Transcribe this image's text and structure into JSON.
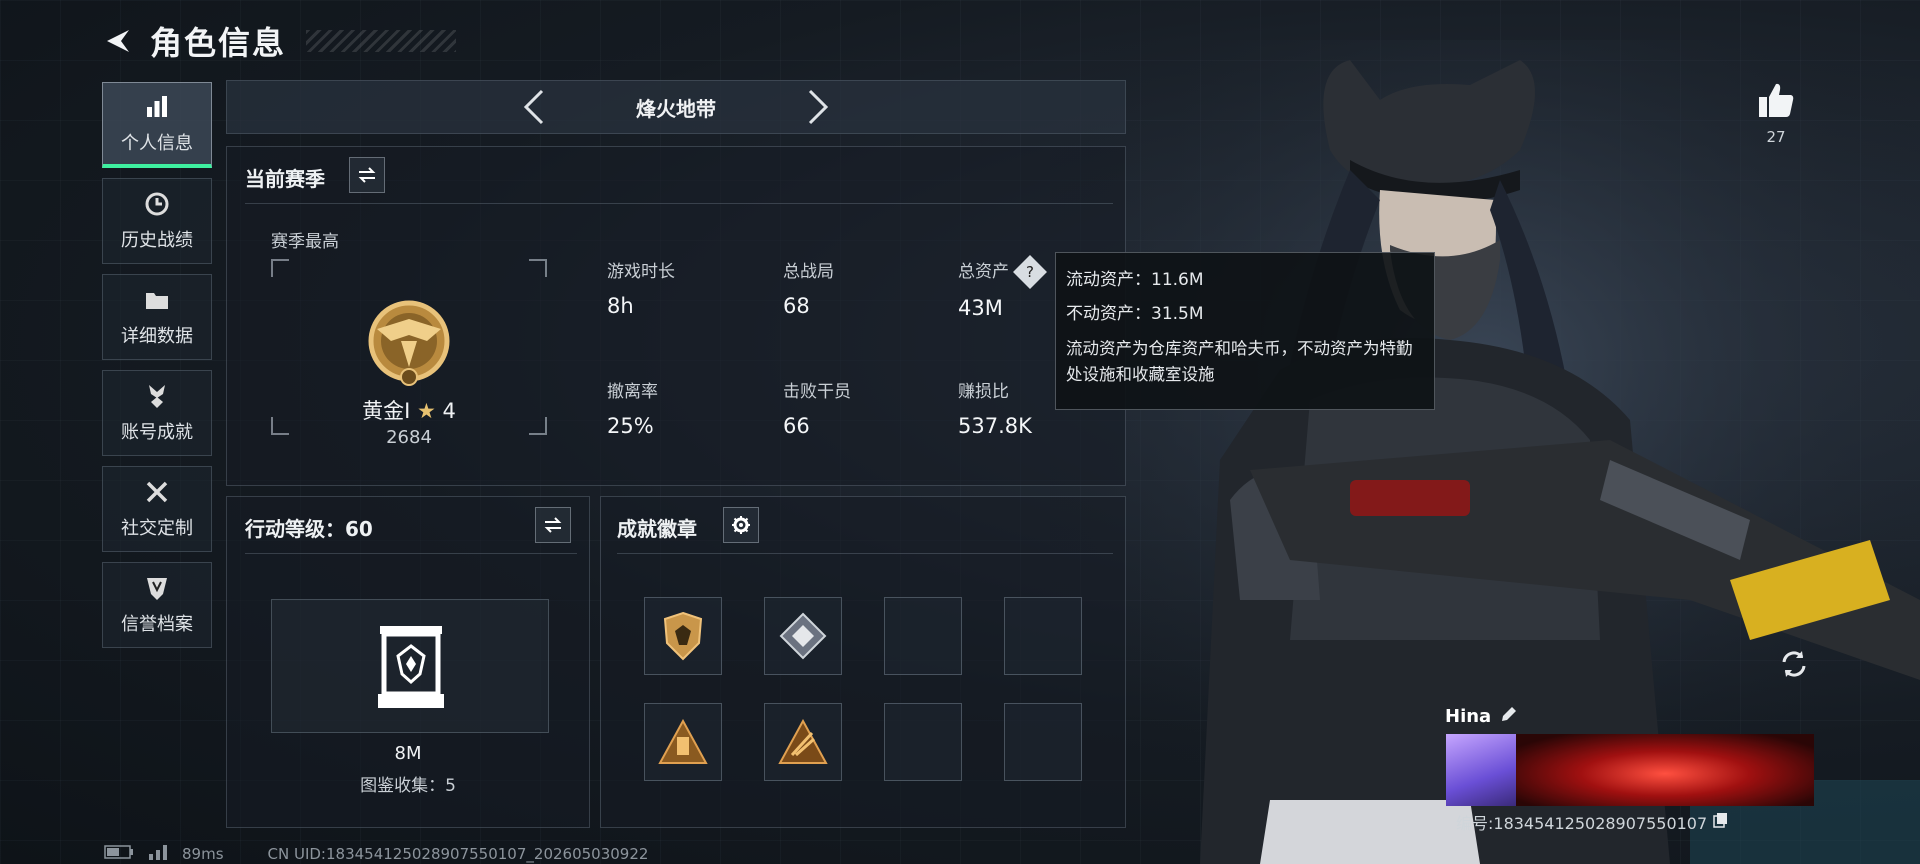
{
  "header": {
    "title": "角色信息"
  },
  "sidebar": {
    "items": [
      {
        "label": "个人信息",
        "icon": "bar-chart-icon",
        "active": true
      },
      {
        "label": "历史战绩",
        "icon": "clock-icon",
        "active": false
      },
      {
        "label": "详细数据",
        "icon": "folder-icon",
        "active": false
      },
      {
        "label": "账号成就",
        "icon": "medal-icon",
        "active": false
      },
      {
        "label": "社交定制",
        "icon": "tools-icon",
        "active": false
      },
      {
        "label": "信誉档案",
        "icon": "shield-icon",
        "active": false
      }
    ]
  },
  "map_selector": {
    "name": "烽火地带"
  },
  "season": {
    "title": "当前赛季",
    "rank_caption": "赛季最高",
    "rank_name": "黄金Ⅰ",
    "rank_stars": "4",
    "rank_score": "2684",
    "stats": [
      {
        "label": "游戏时长",
        "value": "8h"
      },
      {
        "label": "总战局",
        "value": "68"
      },
      {
        "label": "总资产",
        "value": "43M"
      },
      {
        "label": "撤离率",
        "value": "25%"
      },
      {
        "label": "击败干员",
        "value": "66"
      },
      {
        "label": "赚损比",
        "value": "537.8K"
      }
    ]
  },
  "tooltip": {
    "liquid": "流动资产：11.6M",
    "fixed": "不动资产：31.5M",
    "description": "流动资产为仓库资产和哈夫币，不动资产为特勤处设施和收藏室设施"
  },
  "level": {
    "title": "行动等级：60",
    "value": "8M",
    "collection": "图鉴收集：5"
  },
  "badges": {
    "title": "成就徽章",
    "slots": [
      "shield-badge",
      "diamond-badge",
      "",
      "",
      "triangle-badge",
      "triangle-badge-gold",
      "",
      ""
    ]
  },
  "like": {
    "count": "27"
  },
  "player": {
    "name": "Hina",
    "id": "编号:1834541250289075501​07"
  },
  "footer": {
    "ping": "89ms",
    "uid": "CN UID:1834541250289075501​07_202605030922"
  },
  "colors": {
    "accent": "#3ef0a0",
    "gold": "#c99a4a"
  }
}
